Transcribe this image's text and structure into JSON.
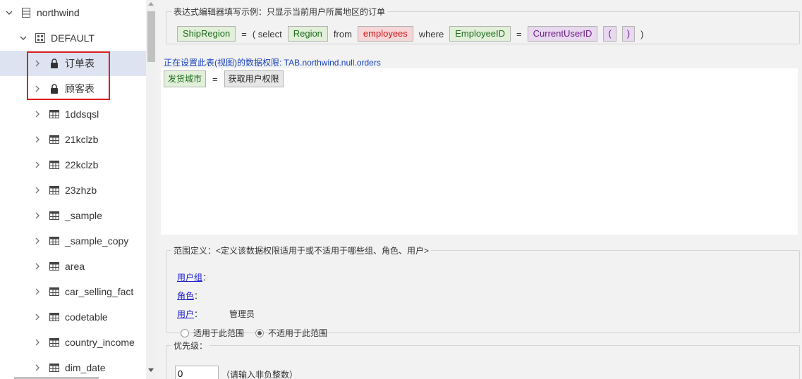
{
  "tree": {
    "root": {
      "label": "northwind",
      "icon": "database-icon"
    },
    "schema": {
      "label": "DEFAULT",
      "icon": "schema-icon"
    },
    "items": [
      {
        "label": "订单表",
        "icon": "lock-icon",
        "selected": true
      },
      {
        "label": "顾客表",
        "icon": "lock-icon",
        "selected": false
      },
      {
        "label": "1ddsqsl",
        "icon": "table-icon"
      },
      {
        "label": "21kclzb",
        "icon": "table-icon"
      },
      {
        "label": "22kclzb",
        "icon": "table-icon"
      },
      {
        "label": "23zhzb",
        "icon": "table-icon"
      },
      {
        "label": "_sample",
        "icon": "table-icon"
      },
      {
        "label": "_sample_copy",
        "icon": "table-icon"
      },
      {
        "label": "area",
        "icon": "table-icon"
      },
      {
        "label": "car_selling_fact",
        "icon": "table-icon"
      },
      {
        "label": "codetable",
        "icon": "table-icon"
      },
      {
        "label": "country_income",
        "icon": "table-icon"
      },
      {
        "label": "dim_date",
        "icon": "table-icon"
      }
    ]
  },
  "example": {
    "legend": "表达式编辑器填写示例：只显示当前用户所属地区的订单",
    "tokens": {
      "field1": "ShipRegion",
      "eq1": "=",
      "lparen_select": "( select",
      "region": "Region",
      "from": "from",
      "table": "employees",
      "where": "where",
      "field2": "EmployeeID",
      "eq2": "=",
      "func": "CurrentUserID",
      "paren_open": "(",
      "paren_close": ")",
      "rparen": ")"
    }
  },
  "target": {
    "label": "正在设置此表(视图)的数据权限: TAB.northwind.null.orders"
  },
  "editor": {
    "field_button": "发货城市",
    "eq": "=",
    "func_button": "获取用户权限"
  },
  "scope": {
    "legend": "范围定义：<定义该数据权限适用于或不适用于哪些组、角色、用户>",
    "group_link": "用户组",
    "group_colon": "：",
    "role_link": "角色",
    "role_colon": "：",
    "user_link": "用户",
    "user_colon": "：",
    "user_value": "管理员",
    "radio_apply": "适用于此范围",
    "radio_not_apply": "不适用于此范围",
    "selected": "not_apply"
  },
  "priority": {
    "legend": "优先级：",
    "value": "0",
    "hint": "（请输入非负整数）"
  },
  "colors": {
    "highlight_box": "#e0201c",
    "selected_row": "#dde3f0",
    "link_blue": "#1a44bf"
  }
}
